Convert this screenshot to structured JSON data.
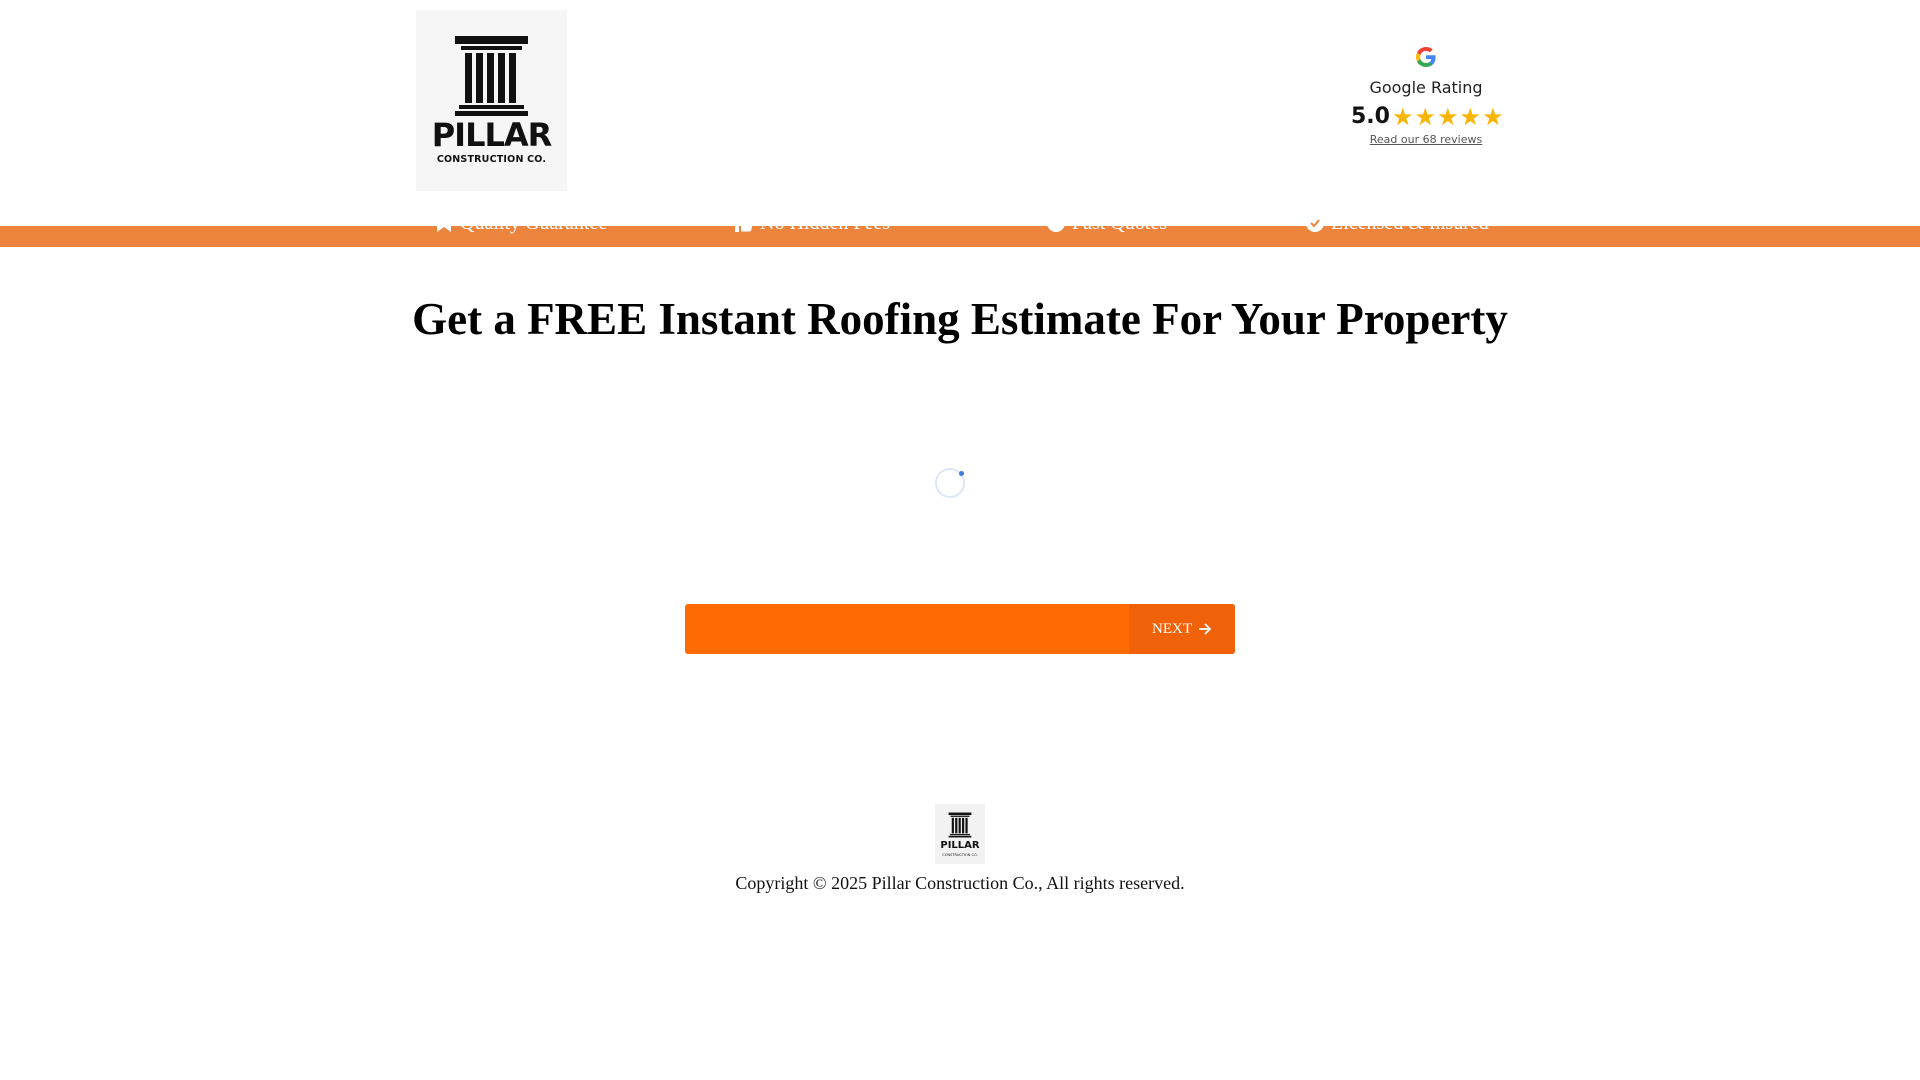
{
  "header": {
    "logo": {
      "word": "PILLAR",
      "sub": "CONSTRUCTION CO."
    },
    "rating": {
      "title": "Google Rating",
      "score": "5.0",
      "stars": 5,
      "link": "Read our 68 reviews",
      "star_color": "#f7b500"
    }
  },
  "trust_bar": {
    "color": "#ed843e",
    "items": [
      {
        "label": "Quality Guarantee",
        "icon": "ribbon-icon"
      },
      {
        "label": "No Hidden Fees",
        "icon": "thumbs-up-icon"
      },
      {
        "label": "Fast Quotes",
        "icon": "clock-icon"
      },
      {
        "label": "Licensed & Insured",
        "icon": "check-circle-icon"
      }
    ]
  },
  "main": {
    "title": "Get a FREE Instant Roofing Estimate For Your Property",
    "next_label": "NEXT",
    "accent": "#fe6b04"
  },
  "footer": {
    "logo": {
      "word": "PILLAR",
      "sub": "CONSTRUCTION CO."
    },
    "copyright": "Copyright © 2025  Pillar Construction Co., All rights reserved."
  }
}
